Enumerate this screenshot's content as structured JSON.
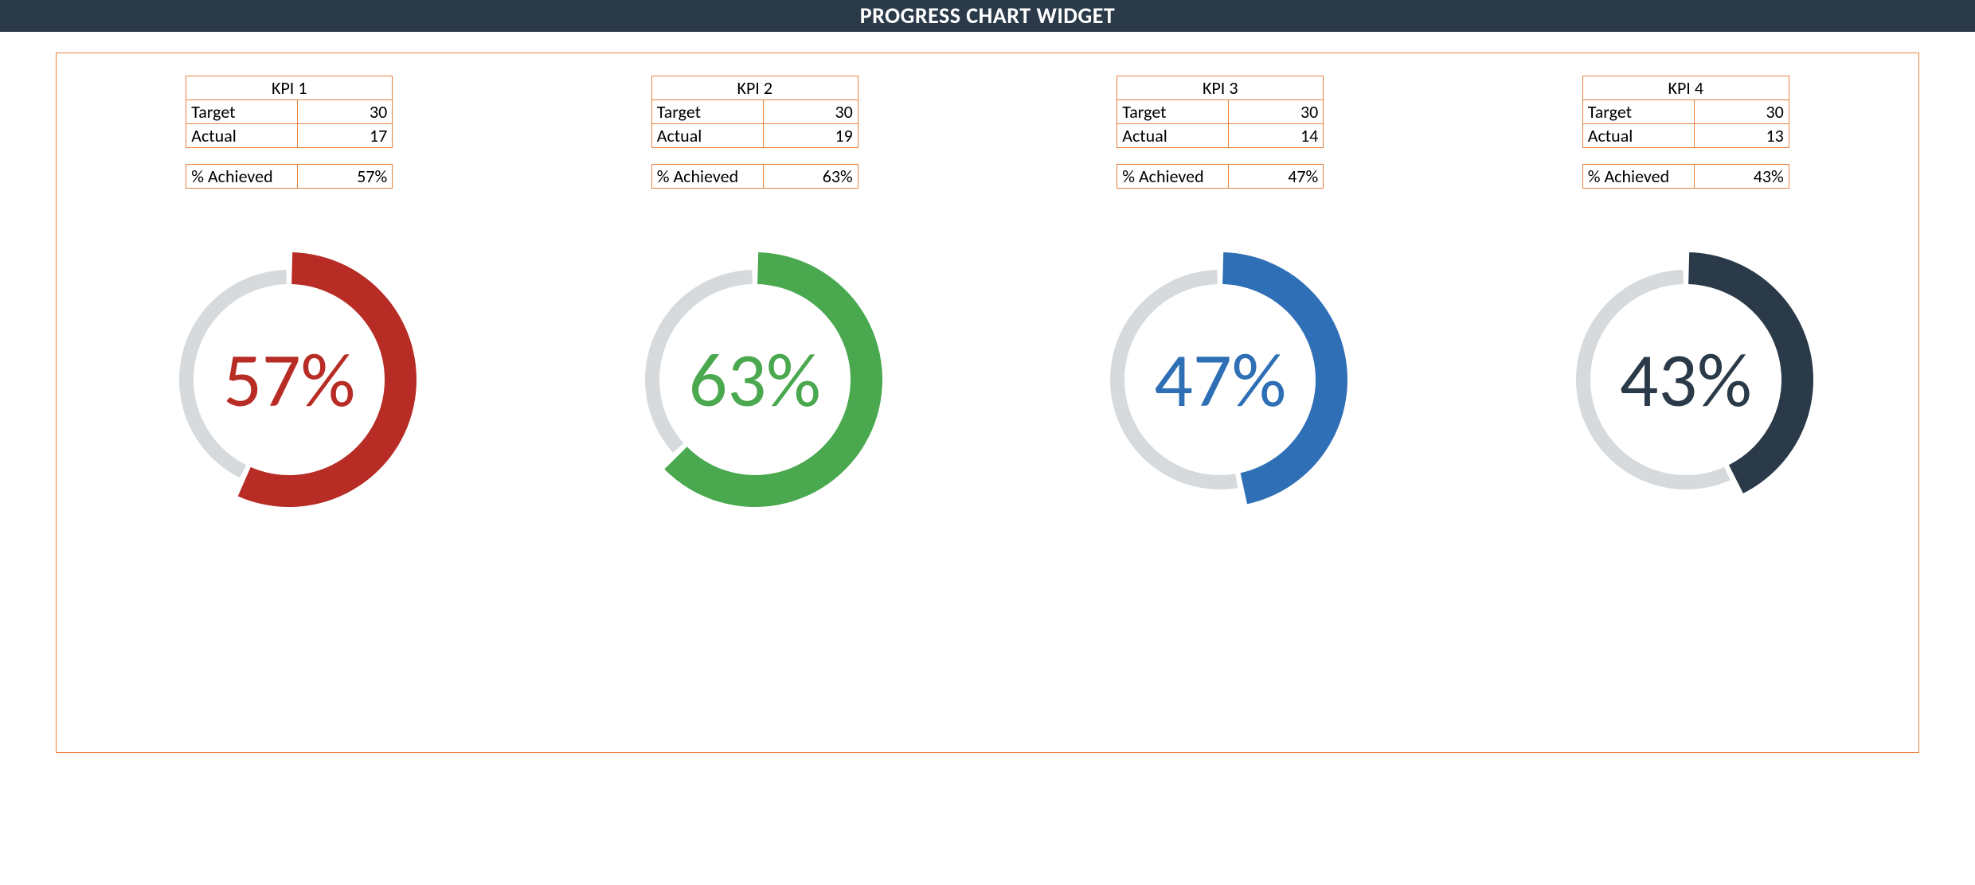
{
  "title": "PROGRESS CHART WIDGET",
  "labels": {
    "target": "Target",
    "actual": "Actual",
    "achieved": "% Achieved"
  },
  "colors": {
    "track": "#d6dadd",
    "kpi": [
      "#b72c25",
      "#4aa84e",
      "#2f6fb6",
      "#2b3a49"
    ]
  },
  "kpis": [
    {
      "name": "KPI 1",
      "target": 30,
      "actual": 17,
      "percent": 57,
      "percent_label": "57%"
    },
    {
      "name": "KPI 2",
      "target": 30,
      "actual": 19,
      "percent": 63,
      "percent_label": "63%"
    },
    {
      "name": "KPI 3",
      "target": 30,
      "actual": 14,
      "percent": 47,
      "percent_label": "47%"
    },
    {
      "name": "KPI 4",
      "target": 30,
      "actual": 13,
      "percent": 43,
      "percent_label": "43%"
    }
  ],
  "chart_data": [
    {
      "type": "pie",
      "title": "KPI 1",
      "categories": [
        "Achieved",
        "Remaining"
      ],
      "values": [
        57,
        43
      ],
      "center_label": "57%",
      "ylim": [
        0,
        100
      ]
    },
    {
      "type": "pie",
      "title": "KPI 2",
      "categories": [
        "Achieved",
        "Remaining"
      ],
      "values": [
        63,
        37
      ],
      "center_label": "63%",
      "ylim": [
        0,
        100
      ]
    },
    {
      "type": "pie",
      "title": "KPI 3",
      "categories": [
        "Achieved",
        "Remaining"
      ],
      "values": [
        47,
        53
      ],
      "center_label": "47%",
      "ylim": [
        0,
        100
      ]
    },
    {
      "type": "pie",
      "title": "KPI 4",
      "categories": [
        "Achieved",
        "Remaining"
      ],
      "values": [
        43,
        57
      ],
      "center_label": "43%",
      "ylim": [
        0,
        100
      ]
    }
  ]
}
